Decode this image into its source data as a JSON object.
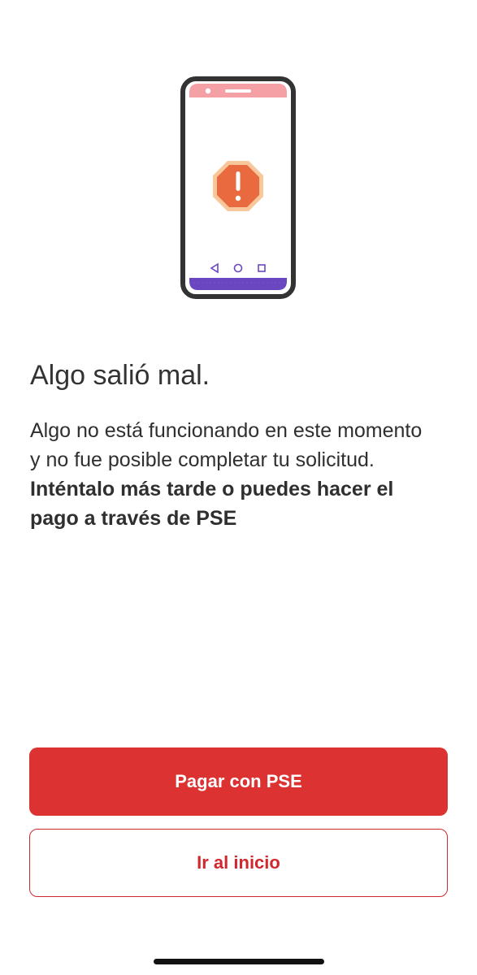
{
  "error": {
    "title": "Algo salió mal.",
    "message_regular": "Algo no está funcionando en este momento y no fue posible completar tu solicitud. ",
    "message_bold": "Inténtalo más tarde o puedes hacer el pago a través de PSE"
  },
  "actions": {
    "primary_label": "Pagar con PSE",
    "secondary_label": "Ir al inicio"
  },
  "icons": {
    "illustration": "phone-warning-icon",
    "warning": "warning-octagon-icon"
  },
  "colors": {
    "primary_red": "#dc3232",
    "warning_orange": "#e96a3e",
    "phone_header_pink": "#f4a0a4",
    "phone_nav_purple": "#6b46c1"
  }
}
